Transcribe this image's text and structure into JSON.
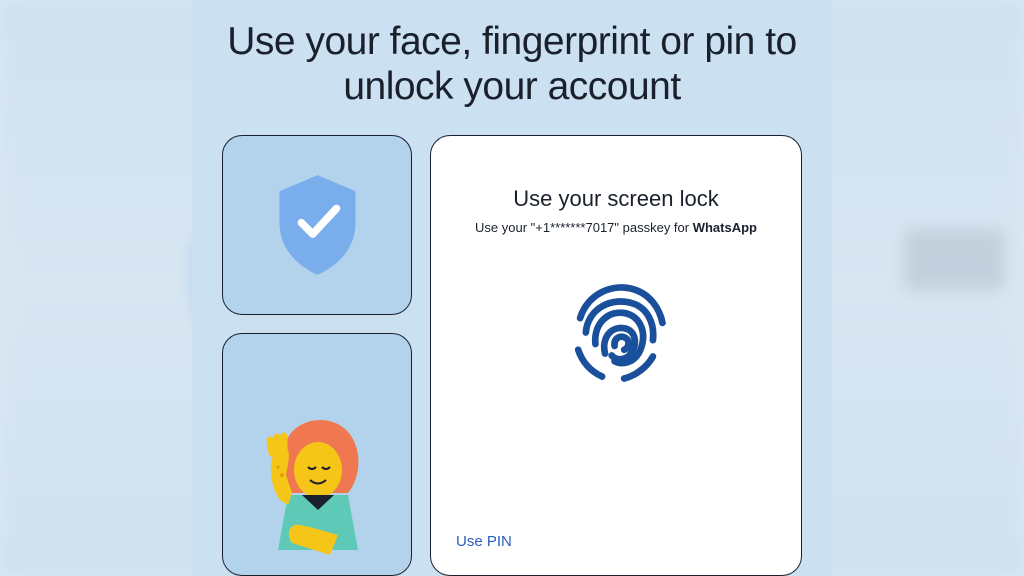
{
  "headline": "Use your face, fingerprint or pin to unlock your account",
  "card": {
    "title": "Use your screen lock",
    "subtitle_prefix": "Use your \"",
    "phone_masked": "+1*******7017",
    "subtitle_mid": "\" passkey for ",
    "app_name": "WhatsApp",
    "use_pin_label": "Use PIN"
  },
  "colors": {
    "shield": "#7aadec",
    "fingerprint": "#1a4f9c",
    "accent_link": "#2b5fb8"
  }
}
